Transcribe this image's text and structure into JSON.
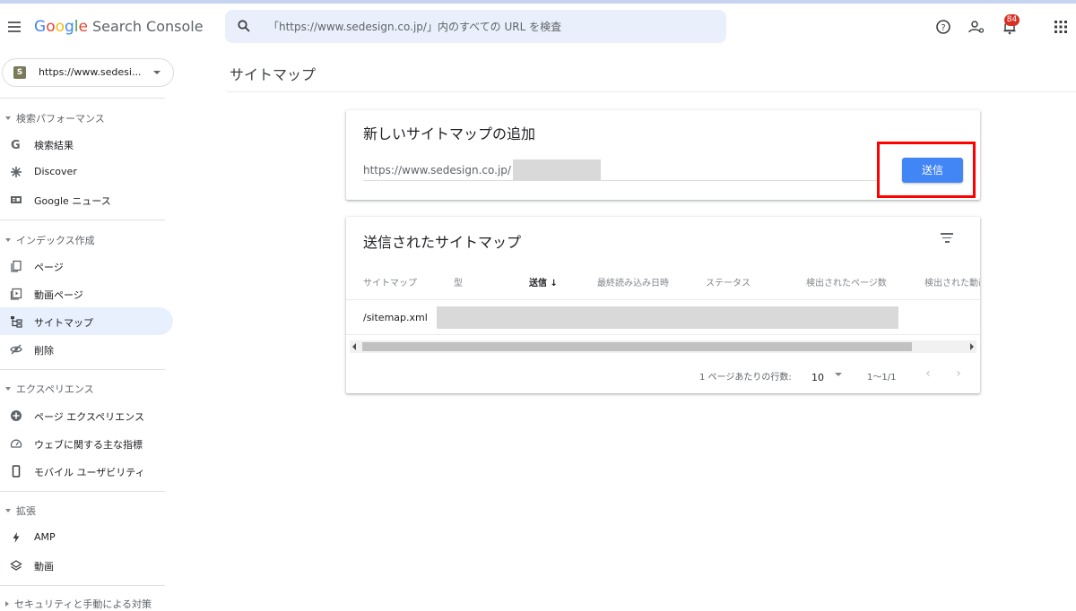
{
  "header": {
    "brand_google": "Google",
    "brand_product": "Search Console",
    "search_text": "「https://www.sedesign.co.jp/」内のすべての URL を検査",
    "notifications_count": "84"
  },
  "sidebar": {
    "property_logo": "S",
    "property_label": "https://www.sedesi...",
    "sections": [
      {
        "title": "検索パフォーマンス",
        "items": [
          {
            "icon": "google-g-icon",
            "label": "検索結果"
          },
          {
            "icon": "discover-asterisk-icon",
            "label": "Discover"
          },
          {
            "icon": "google-news-icon",
            "label": "Google ニュース"
          }
        ]
      },
      {
        "title": "インデックス作成",
        "items": [
          {
            "icon": "pages-icon",
            "label": "ページ"
          },
          {
            "icon": "video-pages-icon",
            "label": "動画ページ"
          },
          {
            "icon": "sitemap-icon",
            "label": "サイトマップ",
            "active": true
          },
          {
            "icon": "removals-icon",
            "label": "削除"
          }
        ]
      },
      {
        "title": "エクスペリエンス",
        "items": [
          {
            "icon": "page-experience-icon",
            "label": "ページ エクスペリエンス"
          },
          {
            "icon": "core-web-vitals-icon",
            "label": "ウェブに関する主な指標"
          },
          {
            "icon": "mobile-icon",
            "label": "モバイル ユーザビリティ"
          }
        ]
      },
      {
        "title": "拡張",
        "items": [
          {
            "icon": "amp-bolt-icon",
            "label": "AMP"
          },
          {
            "icon": "video-layers-icon",
            "label": "動画"
          }
        ]
      },
      {
        "title": "セキュリティと手動による対策",
        "items": []
      }
    ]
  },
  "main": {
    "page_title": "サイトマップ",
    "add_card": {
      "title": "新しいサイトマップの追加",
      "url_prefix": "https://www.sedesign.co.jp/",
      "submit_label": "送信",
      "highlight_color": "#ff0000"
    },
    "submitted_card": {
      "title": "送信されたサイトマップ",
      "columns": [
        "サイトマップ",
        "型",
        "送信",
        "最終読み込み日時",
        "ステータス",
        "検出されたページ数",
        "検出された動画数"
      ],
      "sort_arrow": "↓",
      "rows": [
        {
          "sitemap": "/sitemap.xml"
        }
      ],
      "rows_per_page_label": "1 ページあたりの行数:",
      "rows_per_page_value": "10",
      "range_label": "1〜1/1",
      "prev": "‹",
      "next": "›"
    }
  },
  "colors": {
    "accent": "#4285f4",
    "active_nav_bg": "#e8f0fe",
    "search_bg": "#eaf0fb"
  }
}
